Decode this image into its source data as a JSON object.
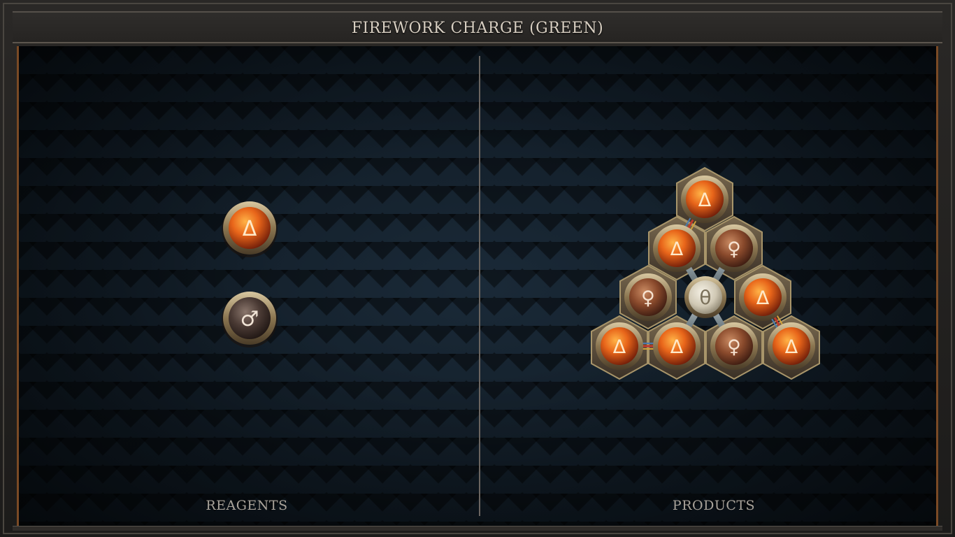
{
  "title": "FIREWORK CHARGE (GREEN)",
  "left_panel": {
    "label": "REAGENTS"
  },
  "right_panel": {
    "label": "PRODUCTS"
  },
  "reagents": [
    {
      "icon": "fire-icon",
      "symbol": "Δ",
      "element": "fire"
    },
    {
      "icon": "mars-icon",
      "symbol": "♂",
      "element": "iron"
    }
  ],
  "product": {
    "center": {
      "icon": "salt-icon",
      "symbol": "θ"
    },
    "atoms": [
      {
        "icon": "fire-icon",
        "symbol": "Δ",
        "element": "fire"
      },
      {
        "icon": "fire-icon",
        "symbol": "Δ",
        "element": "fire"
      },
      {
        "icon": "venus-icon",
        "symbol": "♀",
        "element": "copper"
      },
      {
        "icon": "venus-icon",
        "symbol": "♀",
        "element": "copper"
      },
      {
        "icon": "fire-icon",
        "symbol": "Δ",
        "element": "fire"
      },
      {
        "icon": "fire-icon",
        "symbol": "Δ",
        "element": "fire"
      },
      {
        "icon": "fire-icon",
        "symbol": "Δ",
        "element": "fire"
      },
      {
        "icon": "venus-icon",
        "symbol": "♀",
        "element": "copper"
      },
      {
        "icon": "fire-icon",
        "symbol": "Δ",
        "element": "fire"
      }
    ]
  },
  "colors": {
    "fire": "#e8651a",
    "copper": "#8a4a2c",
    "iron": "#4a3a34",
    "salt": "#d8d2c2",
    "border_accent": "#7a4a25"
  }
}
